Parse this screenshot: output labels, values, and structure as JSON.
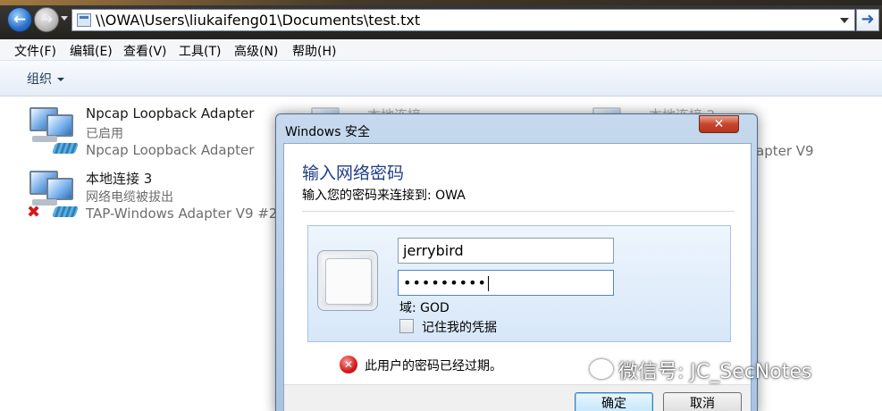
{
  "address_bar": {
    "path": "\\\\OWA\\Users\\liukaifeng01\\Documents\\test.txt"
  },
  "menu": {
    "items": [
      "文件(F)",
      "编辑(E)",
      "查看(V)",
      "工具(T)",
      "高级(N)",
      "帮助(H)"
    ]
  },
  "command_bar": {
    "organize": "组织"
  },
  "adapters": [
    {
      "name": "Npcap Loopback Adapter",
      "status": "已启用",
      "device": "Npcap Loopback Adapter"
    },
    {
      "name": "本地连接 3",
      "status": "网络电缆被拔出",
      "device": "TAP-Windows Adapter V9 #2"
    }
  ],
  "background_items": {
    "local_conn": "本地连接",
    "local_conn_2": "本地连接 2",
    "adapter_v9": "apter V9"
  },
  "dialog": {
    "title": "Windows 安全",
    "heading": "输入网络密码",
    "subtitle": "输入您的密码来连接到: OWA",
    "username": "jerrybird",
    "password_mask": "•••••••••",
    "domain": "域: GOD",
    "remember": "记住我的凭据",
    "error": "此用户的密码已经过期。",
    "ok": "确定",
    "cancel": "取消",
    "close": "✕"
  },
  "watermark": "微信号: JC_SecNotes",
  "icons": {
    "back": "back-arrow-icon",
    "forward": "forward-arrow-icon",
    "go": "go-arrow-icon",
    "error": "error-icon"
  }
}
